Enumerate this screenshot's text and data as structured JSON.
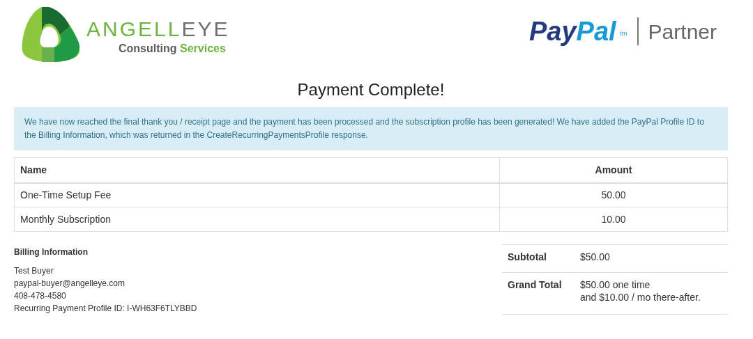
{
  "header": {
    "logo": {
      "name_primary": "ANGELL",
      "name_secondary": "EYE",
      "tagline_primary": "Consulting",
      "tagline_secondary": "Services"
    },
    "partner_logo": {
      "brand_dark": "Pay",
      "brand_light": "Pal",
      "trademark": "tm",
      "label": "Partner"
    }
  },
  "title": "Payment Complete!",
  "notice": "We have now reached the final thank you / receipt page and the payment has been processed and the subscription profile has been generated! We have added the PayPal Profile ID to the Billing Information, which was returned in the CreateRecurringPaymentsProfile response.",
  "items_table": {
    "columns": [
      "Name",
      "Amount"
    ],
    "rows": [
      {
        "name": "One-Time Setup Fee",
        "amount": "50.00"
      },
      {
        "name": "Monthly Subscription",
        "amount": "10.00"
      }
    ]
  },
  "billing": {
    "heading": "Billing Information",
    "lines": [
      "Test Buyer",
      "paypal-buyer@angelleye.com",
      "408-478-4580",
      "Recurring Payment Profile ID: I-WH63F6TLYBBD"
    ]
  },
  "totals": [
    {
      "label": "Subtotal",
      "lines": [
        "$50.00"
      ]
    },
    {
      "label": "Grand Total",
      "lines": [
        "$50.00 one time",
        "and $10.00 / mo there-after."
      ]
    }
  ]
}
